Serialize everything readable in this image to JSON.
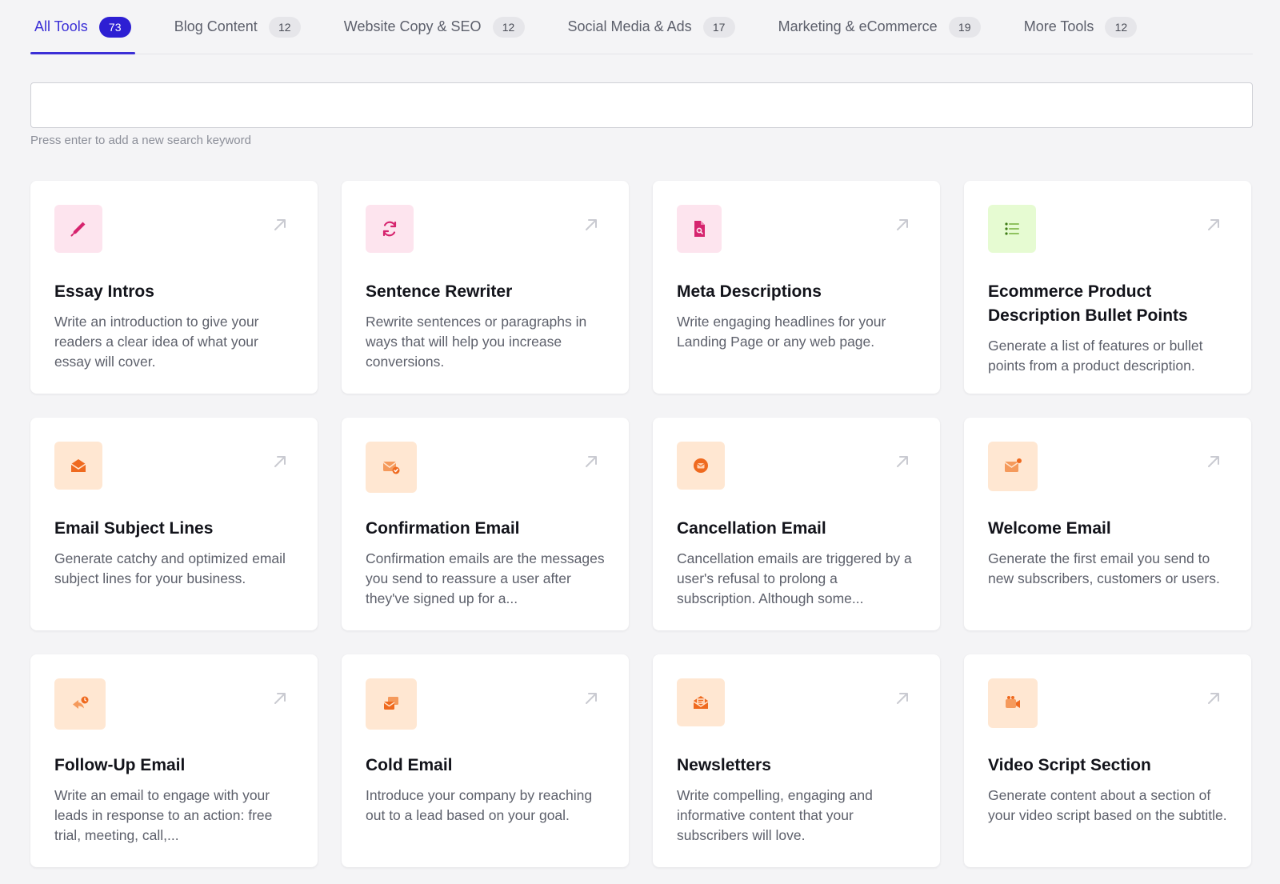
{
  "tabs": [
    {
      "label": "All Tools",
      "count": "73",
      "active": true
    },
    {
      "label": "Blog Content",
      "count": "12"
    },
    {
      "label": "Website Copy & SEO",
      "count": "12"
    },
    {
      "label": "Social Media & Ads",
      "count": "17"
    },
    {
      "label": "Marketing & eCommerce",
      "count": "19"
    },
    {
      "label": "More Tools",
      "count": "12"
    }
  ],
  "search": {
    "value": "",
    "hint": "Press enter to add a new search keyword"
  },
  "colors": {
    "accent": "#2d1fd3",
    "pink_icon": "#d6246e",
    "green_icon": "#3d7a15",
    "orange_icon": "#ef6a1f"
  },
  "cards": [
    {
      "icon": "pen-icon",
      "tone": "pink",
      "title": "Essay Intros",
      "desc": "Write an introduction to give your readers a clear idea of what your essay will cover."
    },
    {
      "icon": "refresh-icon",
      "tone": "pink",
      "title": "Sentence Rewriter",
      "desc": "Rewrite sentences or paragraphs in ways that will help you increase conversions."
    },
    {
      "icon": "file-search-icon",
      "tone": "pink",
      "title": "Meta Descriptions",
      "desc": "Write engaging headlines for your Landing Page or any web page."
    },
    {
      "icon": "list-icon",
      "tone": "green",
      "title": "Ecommerce Product Description Bullet Points",
      "desc": "Generate a list of features or bullet points from a product description."
    },
    {
      "icon": "envelope-open-icon",
      "tone": "orange",
      "title": "Email Subject Lines",
      "desc": "Generate catchy and optimized email subject lines for your business."
    },
    {
      "icon": "mail-check-icon",
      "tone": "orange",
      "title": "Confirmation Email",
      "desc": "Confirmation emails are the messages you send to reassure a user after they've signed up for a..."
    },
    {
      "icon": "mail-circle-icon",
      "tone": "orange",
      "title": "Cancellation Email",
      "desc": "Cancellation emails are triggered by a user's refusal to prolong a subscription. Although some..."
    },
    {
      "icon": "mail-dot-icon",
      "tone": "orange",
      "title": "Welcome Email",
      "desc": "Generate the first email you send to new subscribers, customers or users."
    },
    {
      "icon": "reply-clock-icon",
      "tone": "orange",
      "title": "Follow-Up Email",
      "desc": "Write an email to engage with your leads in response to an action: free trial, meeting, call,..."
    },
    {
      "icon": "mails-icon",
      "tone": "orange",
      "title": "Cold Email",
      "desc": "Introduce your company by reaching out to a lead based on your goal."
    },
    {
      "icon": "newsletter-icon",
      "tone": "orange",
      "title": "Newsletters",
      "desc": "Write compelling, engaging and informative content that your subscribers will love."
    },
    {
      "icon": "video-camera-icon",
      "tone": "orange",
      "title": "Video Script Section",
      "desc": "Generate content about a section of your video script based on the subtitle."
    }
  ]
}
